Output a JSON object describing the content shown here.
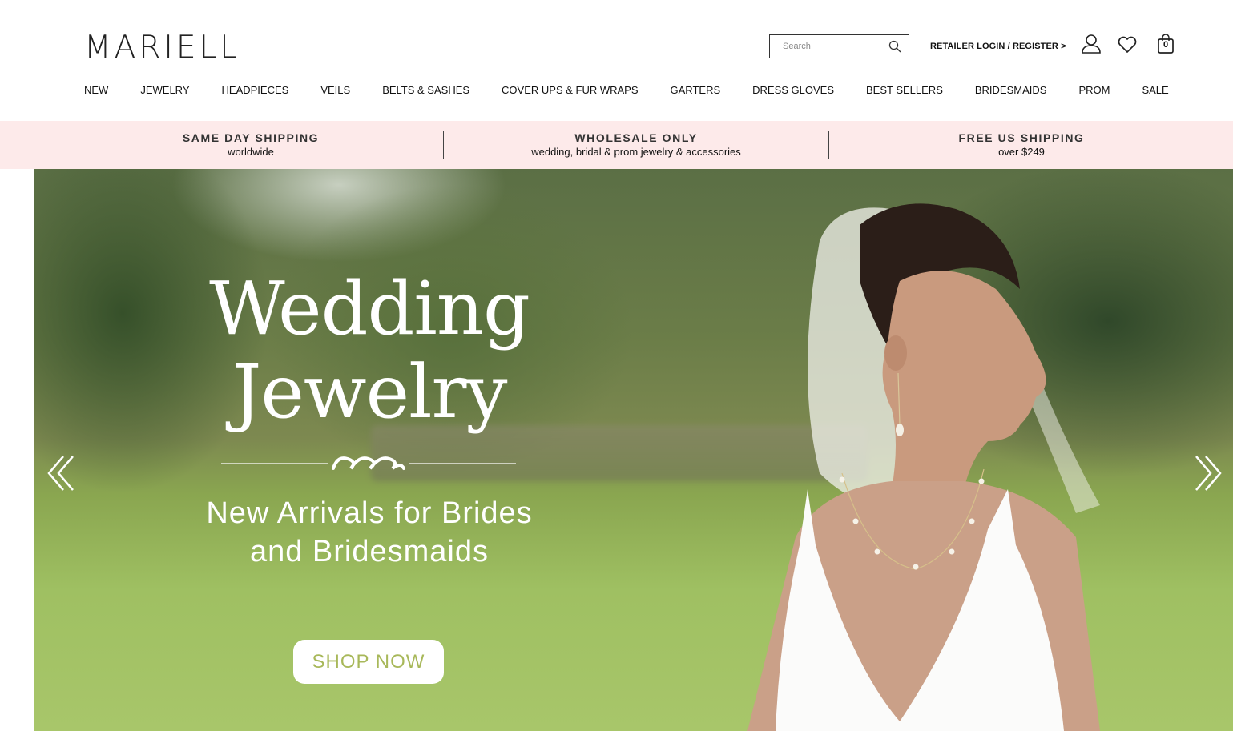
{
  "header": {
    "logo": "MARIELL",
    "search": {
      "placeholder": "Search"
    },
    "retailer_link": "RETAILER LOGIN / REGISTER >",
    "cart_count": "0"
  },
  "nav": {
    "items": [
      "NEW",
      "JEWELRY",
      "HEADPIECES",
      "VEILS",
      "BELTS & SASHES",
      "COVER UPS & FUR WRAPS",
      "GARTERS",
      "DRESS GLOVES",
      "BEST SELLERS",
      "BRIDESMAIDS",
      "PROM",
      "SALE"
    ]
  },
  "promo": [
    {
      "title": "SAME DAY SHIPPING",
      "sub": "worldwide"
    },
    {
      "title": "WHOLESALE ONLY",
      "sub": "wedding, bridal & prom jewelry & accessories"
    },
    {
      "title": "FREE US SHIPPING",
      "sub": "over $249"
    }
  ],
  "hero": {
    "title_line1": "Wedding",
    "title_line2": "Jewelry",
    "subtitle_line1": "New Arrivals for Brides",
    "subtitle_line2": "and Bridesmaids",
    "cta": "SHOP NOW"
  },
  "colors": {
    "promo_bg": "#fdeaea",
    "cta_text": "#a8b85a"
  }
}
